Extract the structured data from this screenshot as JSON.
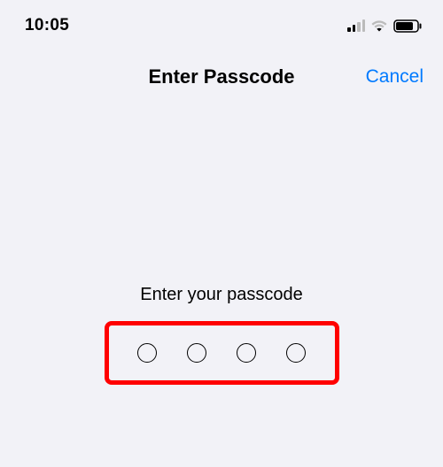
{
  "statusBar": {
    "time": "10:05"
  },
  "navBar": {
    "title": "Enter Passcode",
    "cancel": "Cancel"
  },
  "content": {
    "prompt": "Enter your passcode"
  },
  "colors": {
    "accent": "#007aff",
    "highlight": "#ff0000"
  }
}
